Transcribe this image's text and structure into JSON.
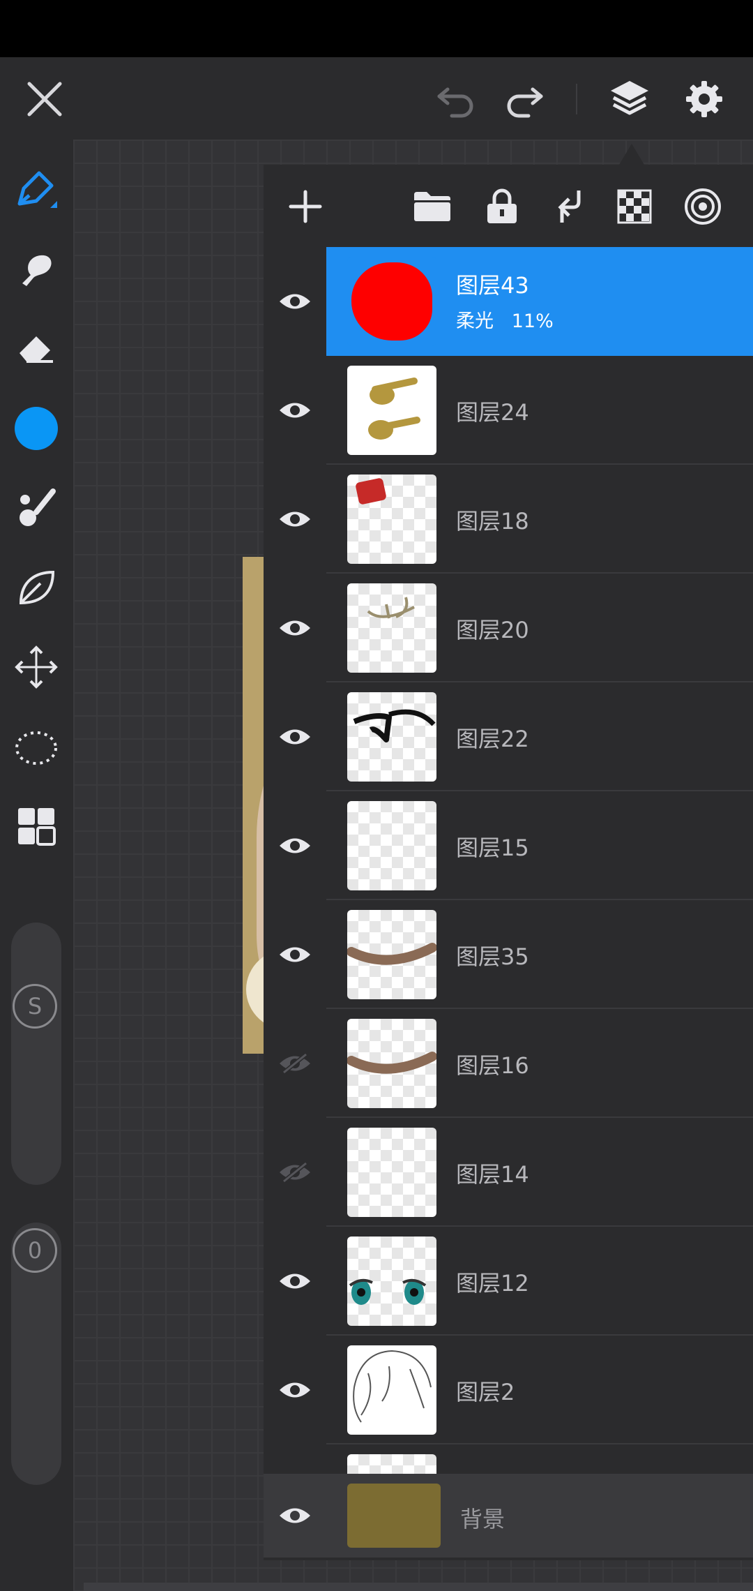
{
  "colors": {
    "accent": "#1f8ef1",
    "selected_row": "#1f8ef1",
    "current_color": "#0a96f5",
    "background_layer": "#7c6c32",
    "panel": "#2b2b2d"
  },
  "topbar": {
    "icons": [
      "close-icon",
      "undo-icon",
      "redo-icon",
      "layers-icon",
      "gear-icon"
    ]
  },
  "sidebar": {
    "tools": [
      "pen-tool-icon",
      "smudge-icon",
      "eraser-icon",
      "color-swatch",
      "brush-icon",
      "leaf-icon",
      "move-icon",
      "lasso-icon",
      "grid-icon"
    ],
    "size_slider_label": "S",
    "opacity_slider_label": "0"
  },
  "layer_panel": {
    "toolbar_icons": [
      "add-icon",
      "folder-icon",
      "lock-icon",
      "merge-down-icon",
      "checker-icon",
      "target-icon"
    ],
    "layers": [
      {
        "name": "图层43",
        "mode": "柔光",
        "opacity": "11%",
        "visible": true,
        "selected": true,
        "thumb": "red-circle"
      },
      {
        "name": "图层24",
        "visible": true,
        "thumb": "gold-hairpins"
      },
      {
        "name": "图层18",
        "visible": true,
        "thumb": "red-patch"
      },
      {
        "name": "图层20",
        "visible": true,
        "thumb": "sketch-ornament"
      },
      {
        "name": "图层22",
        "visible": true,
        "thumb": "black-stroke"
      },
      {
        "name": "图层15",
        "visible": true,
        "thumb": "empty"
      },
      {
        "name": "图层35",
        "visible": true,
        "thumb": "brown-curve"
      },
      {
        "name": "图层16",
        "visible": false,
        "thumb": "brown-curve"
      },
      {
        "name": "图层14",
        "visible": false,
        "thumb": "empty"
      },
      {
        "name": "图层12",
        "visible": true,
        "thumb": "eyes"
      },
      {
        "name": "图层2",
        "visible": true,
        "thumb": "hair-lineart"
      }
    ],
    "background_layer": {
      "name": "背景",
      "visible": true
    }
  }
}
